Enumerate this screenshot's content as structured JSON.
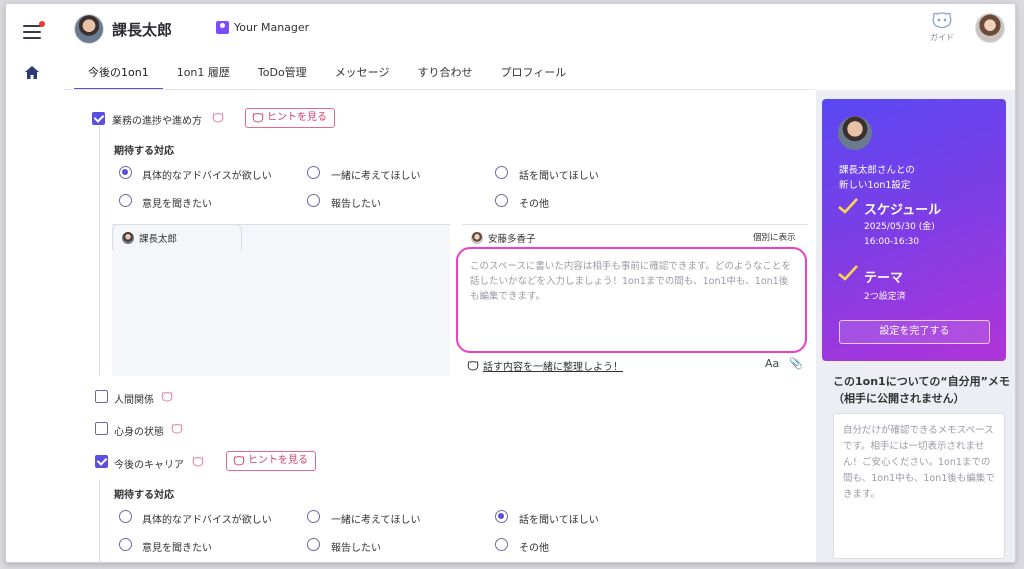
{
  "header": {
    "user_name": "課長太郎",
    "manager_badge": "Your Manager",
    "guide_label": "ガイド"
  },
  "tabs": [
    {
      "label": "今後の1on1"
    },
    {
      "label": "1on1 履歴"
    },
    {
      "label": "ToDo管理"
    },
    {
      "label": "メッセージ"
    },
    {
      "label": "すり合わせ"
    },
    {
      "label": "プロフィール"
    }
  ],
  "topics": {
    "progress": {
      "label": "業務の進捗や進め方",
      "checked": true,
      "hint": "ヒントを見る"
    },
    "relations": {
      "label": "人間関係",
      "checked": false
    },
    "wellbeing": {
      "label": "心身の状態",
      "checked": false
    },
    "career": {
      "label": "今後のキャリア",
      "checked": true,
      "hint": "ヒントを見る"
    }
  },
  "expected": {
    "title": "期待する対応",
    "options": [
      "具体的なアドバイスが欲しい",
      "一緒に考えてほしい",
      "話を聞いてほしい",
      "意見を聞きたい",
      "報告したい",
      "その他"
    ],
    "progress_selected": 0,
    "career_selected": 2
  },
  "notes": {
    "left_owner": "課長太郎",
    "right_owner": "安藤多香子",
    "show_separately": "個別に表示",
    "placeholder": "このスペースに書いた内容は相手も事前に確認できます。どのようなことを話したいかなどを入力しましょう！1on1までの間も、1on1中も、1on1後も編集できます。",
    "organize_link": "話す内容を一緒に整理しよう！",
    "font_button": "Aa"
  },
  "sidebar": {
    "intro_line1": "課長太郎さんとの",
    "intro_line2": "新しい1on1設定",
    "schedule_title": "スケジュール",
    "schedule_date": "2025/05/30 (金)",
    "schedule_time": "16:00-16:30",
    "theme_title": "テーマ",
    "theme_status": "2つ設定済",
    "complete_button": "設定を完了する",
    "memo_title_line1": "この1on1についての“自分用”メモ",
    "memo_title_line2": "（相手に公開されません）",
    "memo_placeholder": "自分だけが確認できるメモスペースです。相手には一切表示されません！ご安心ください。1on1までの間も、1on1中も、1on1後も編集できます。"
  },
  "colors": {
    "accent": "#5b4fe0",
    "highlight": "#ee3fc8",
    "hint": "#d84070"
  }
}
